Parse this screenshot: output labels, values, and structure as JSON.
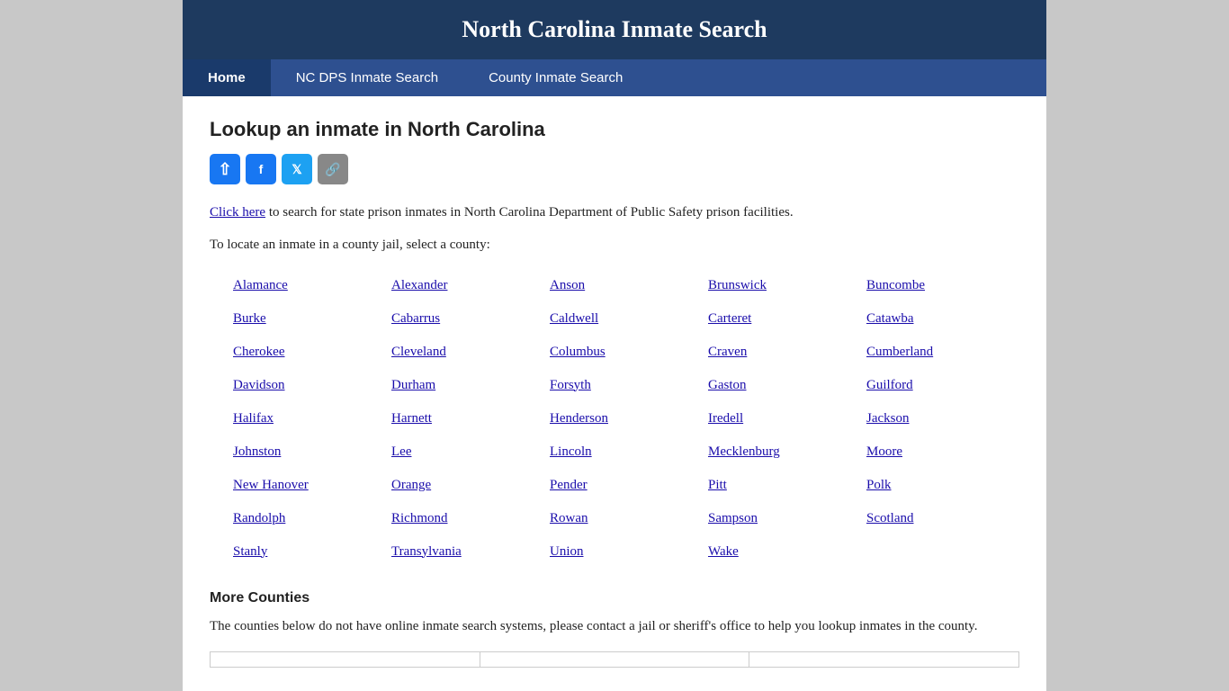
{
  "header": {
    "title": "North Carolina Inmate Search"
  },
  "nav": {
    "items": [
      {
        "label": "Home",
        "active": true
      },
      {
        "label": "NC DPS Inmate Search",
        "active": false
      },
      {
        "label": "County Inmate Search",
        "active": false
      }
    ]
  },
  "page": {
    "title": "Lookup an inmate in North Carolina",
    "description_link": "Click here",
    "description_text": " to search for state prison inmates in North Carolina Department of Public Safety prison facilities.",
    "county_intro": "To locate an inmate in a county jail, select a county:",
    "more_counties_title": "More Counties",
    "more_counties_desc": "The counties below do not have online inmate search systems, please contact a jail or sheriff's office to help you lookup inmates in the county."
  },
  "social": {
    "share_label": "⇧",
    "facebook_label": "f",
    "twitter_label": "t",
    "link_label": "🔗"
  },
  "counties": [
    {
      "name": "Alamance"
    },
    {
      "name": "Alexander"
    },
    {
      "name": "Anson"
    },
    {
      "name": "Brunswick"
    },
    {
      "name": "Buncombe"
    },
    {
      "name": "Burke"
    },
    {
      "name": "Cabarrus"
    },
    {
      "name": "Caldwell"
    },
    {
      "name": "Carteret"
    },
    {
      "name": "Catawba"
    },
    {
      "name": "Cherokee"
    },
    {
      "name": "Cleveland"
    },
    {
      "name": "Columbus"
    },
    {
      "name": "Craven"
    },
    {
      "name": "Cumberland"
    },
    {
      "name": "Davidson"
    },
    {
      "name": "Durham"
    },
    {
      "name": "Forsyth"
    },
    {
      "name": "Gaston"
    },
    {
      "name": "Guilford"
    },
    {
      "name": "Halifax"
    },
    {
      "name": "Harnett"
    },
    {
      "name": "Henderson"
    },
    {
      "name": "Iredell"
    },
    {
      "name": "Jackson"
    },
    {
      "name": "Johnston"
    },
    {
      "name": "Lee"
    },
    {
      "name": "Lincoln"
    },
    {
      "name": "Mecklenburg"
    },
    {
      "name": "Moore"
    },
    {
      "name": "New Hanover"
    },
    {
      "name": "Orange"
    },
    {
      "name": "Pender"
    },
    {
      "name": "Pitt"
    },
    {
      "name": "Polk"
    },
    {
      "name": "Randolph"
    },
    {
      "name": "Richmond"
    },
    {
      "name": "Rowan"
    },
    {
      "name": "Sampson"
    },
    {
      "name": "Scotland"
    },
    {
      "name": "Stanly"
    },
    {
      "name": "Transylvania"
    },
    {
      "name": "Union"
    },
    {
      "name": "Wake"
    }
  ]
}
